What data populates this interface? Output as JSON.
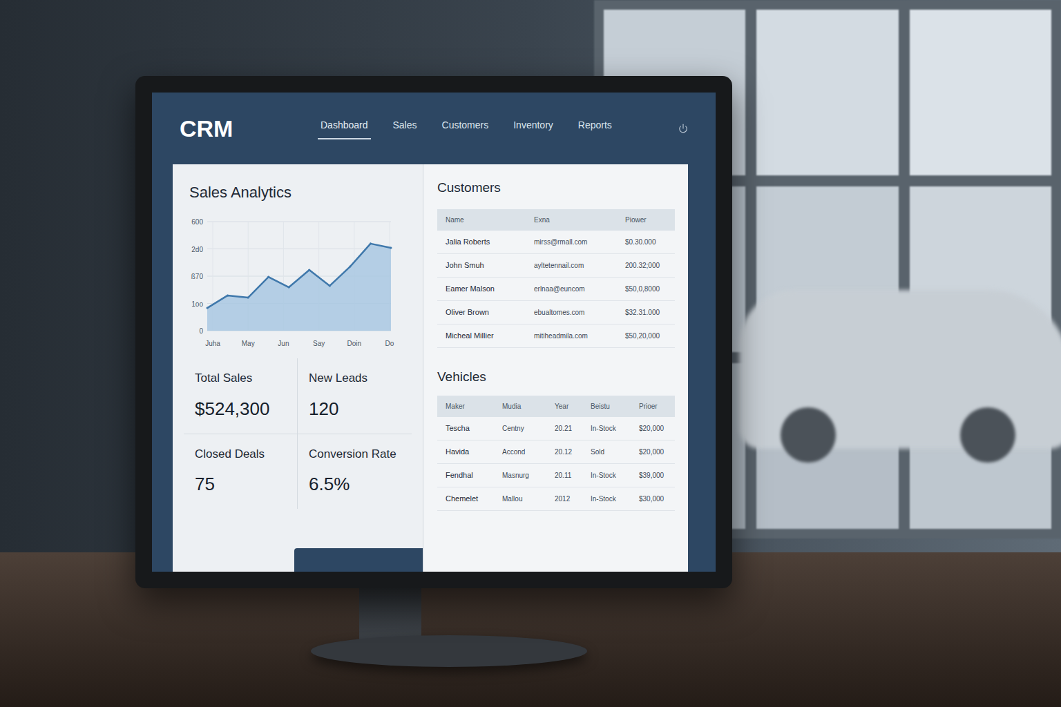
{
  "app": {
    "logo": "CRM"
  },
  "nav": [
    {
      "label": "Dashboard",
      "selected": true
    },
    {
      "label": "Sales",
      "selected": false
    },
    {
      "label": "Customers",
      "selected": false
    },
    {
      "label": "Inventory",
      "selected": false
    },
    {
      "label": "Reports",
      "selected": false
    }
  ],
  "sales_analytics": {
    "title": "Sales Analytics",
    "chart": {
      "y_ticks": [
        "600",
        "2d0",
        "ß70",
        "1oo",
        "0"
      ],
      "x_labels": [
        "Juha",
        "May",
        "Jun",
        "Say",
        "Doin",
        "Do"
      ],
      "values": [
        125,
        194,
        182,
        296,
        239,
        334,
        247,
        353,
        479,
        456
      ]
    }
  },
  "stats": [
    {
      "label": "Total Sales",
      "value": "$524,300"
    },
    {
      "label": "New Leads",
      "value": "120"
    },
    {
      "label": "Closed Deals",
      "value": "75"
    },
    {
      "label": "Conversion Rate",
      "value": "6.5%"
    }
  ],
  "customers": {
    "title": "Customers",
    "columns": [
      "Name",
      "Exna",
      "Piower"
    ],
    "rows": [
      [
        "Jalia Roberts",
        "mirss@rmall.com",
        "$0.30.000"
      ],
      [
        "John Smuh",
        "ayltetennail.com",
        "200.32;000"
      ],
      [
        "Eamer Malson",
        "erlnaa@euncom",
        "$50,0,8000"
      ],
      [
        "Oliver Brown",
        "ebualtomes.com",
        "$32.31.000"
      ],
      [
        "Micheal Millier",
        "mitiheadmila.com",
        "$50,20,000"
      ]
    ]
  },
  "vehicles": {
    "title": "Vehicles",
    "columns": [
      "Maker",
      "Mudia",
      "Year",
      "Beistu",
      "Prioer"
    ],
    "rows": [
      [
        "Tescha",
        "Centny",
        "20.21",
        "In-Stock",
        "$20,000"
      ],
      [
        "Havida",
        "Accond",
        "20.12",
        "Sold",
        "$20,000"
      ],
      [
        "Fendhal",
        "Masnurg",
        "20.11",
        "In-Stock",
        "$39,000"
      ],
      [
        "Chemelet",
        "Mallou",
        "2012",
        "In-Stock",
        "$30,000"
      ]
    ]
  }
}
